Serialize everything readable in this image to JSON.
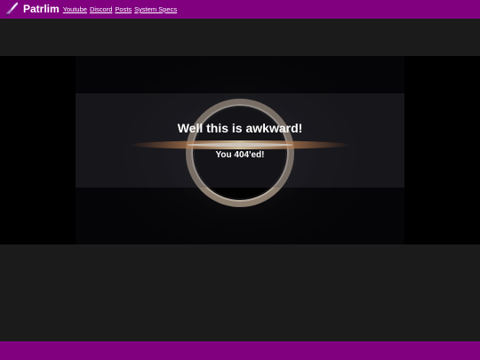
{
  "header": {
    "title": "Patrlim",
    "logo_icon": "paintbrush-icon",
    "nav": [
      {
        "label": "Youtube"
      },
      {
        "label": "Discord"
      },
      {
        "label": "Posts"
      },
      {
        "label": "System Specs"
      }
    ]
  },
  "hero": {
    "title": "Well this is awkward!",
    "subtitle": "You 404'ed!"
  },
  "colors": {
    "brand": "#800080",
    "background": "#1b1b1b",
    "hero_background": "#000000",
    "text": "#ffffff"
  }
}
